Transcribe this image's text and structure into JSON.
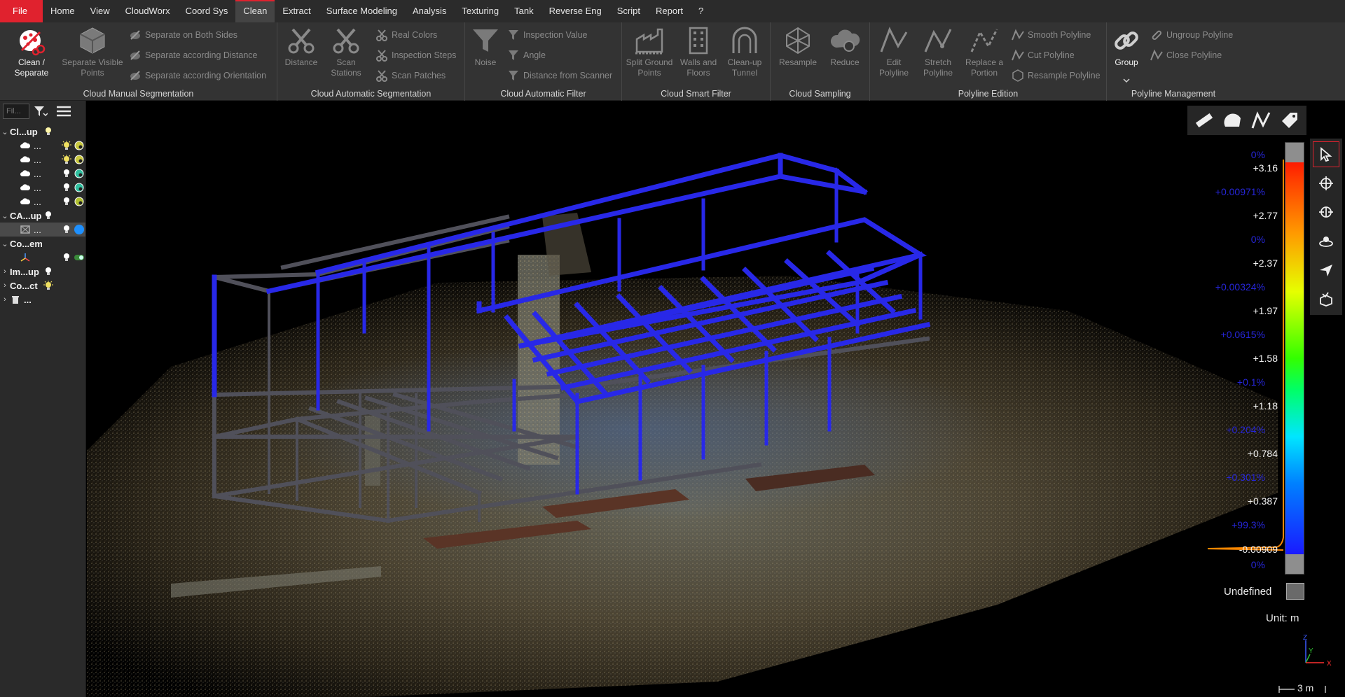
{
  "menu": {
    "items": [
      "File",
      "Home",
      "View",
      "CloudWorx",
      "Coord Sys",
      "Clean",
      "Extract",
      "Surface Modeling",
      "Analysis",
      "Texturing",
      "Tank",
      "Reverse Eng",
      "Script",
      "Report",
      "?"
    ],
    "active": "Clean"
  },
  "ribbon": {
    "manual_segmentation": {
      "label": "Cloud Manual Segmentation",
      "clean_separate": "Clean / Separate",
      "separate_visible": "Separate Visible Points",
      "both_sides": "Separate on Both Sides",
      "by_distance": "Separate according Distance",
      "by_orientation": "Separate according Orientation"
    },
    "auto_segmentation": {
      "label": "Cloud Automatic Segmentation",
      "distance": "Distance",
      "scan_stations": "Scan Stations",
      "real_colors": "Real Colors",
      "inspection_steps": "Inspection Steps",
      "scan_patches": "Scan Patches"
    },
    "auto_filter": {
      "label": "Cloud Automatic Filter",
      "noise": "Noise",
      "inspection_value": "Inspection Value",
      "angle": "Angle",
      "distance_from_scanner": "Distance from Scanner"
    },
    "smart_filter": {
      "label": "Cloud Smart Filter",
      "split_ground": "Split Ground Points",
      "walls_floors": "Walls and Floors",
      "cleanup_tunnel": "Clean-up Tunnel"
    },
    "sampling": {
      "label": "Cloud Sampling",
      "resample": "Resample",
      "reduce": "Reduce"
    },
    "polyline_edition": {
      "label": "Polyline Edition",
      "edit": "Edit Polyline",
      "stretch": "Stretch Polyline",
      "replace": "Replace a Portion",
      "smooth": "Smooth Polyline",
      "cut": "Cut Polyline",
      "resample": "Resample Polyline"
    },
    "polyline_management": {
      "label": "Polyline Management",
      "group": "Group",
      "ungroup": "Ungroup Polyline",
      "close": "Close Polyline"
    }
  },
  "tree": {
    "filter_placeholder": "Fil...",
    "rows": [
      {
        "label": "Cl...up"
      },
      {
        "label": "..."
      },
      {
        "label": "..."
      },
      {
        "label": "..."
      },
      {
        "label": "..."
      },
      {
        "label": "..."
      },
      {
        "label": "CA...up"
      },
      {
        "label": "..."
      },
      {
        "label": "Co...em"
      },
      {
        "label": ""
      },
      {
        "label": "Im...up"
      },
      {
        "label": "Co...ct"
      },
      {
        "label": "..."
      }
    ]
  },
  "scale": {
    "labels": [
      {
        "text": "0%",
        "kind": "pct"
      },
      {
        "text": "+3.16",
        "kind": "val"
      },
      {
        "text": "+0.00971%",
        "kind": "pct"
      },
      {
        "text": "+2.77",
        "kind": "val"
      },
      {
        "text": "0%",
        "kind": "pct"
      },
      {
        "text": "+2.37",
        "kind": "val"
      },
      {
        "text": "+0.00324%",
        "kind": "pct"
      },
      {
        "text": "+1.97",
        "kind": "val"
      },
      {
        "text": "+0.0615%",
        "kind": "pct"
      },
      {
        "text": "+1.58",
        "kind": "val"
      },
      {
        "text": "+0.1%",
        "kind": "pct"
      },
      {
        "text": "+1.18",
        "kind": "val"
      },
      {
        "text": "+0.204%",
        "kind": "pct"
      },
      {
        "text": "+0.784",
        "kind": "val"
      },
      {
        "text": "+0.301%",
        "kind": "pct"
      },
      {
        "text": "+0.387",
        "kind": "val"
      },
      {
        "text": "+99.3%",
        "kind": "pct"
      },
      {
        "text": "-0.00909",
        "kind": "val"
      },
      {
        "text": "0%",
        "kind": "pct"
      }
    ],
    "undefined_label": "Undefined",
    "unit_label": "Unit: m",
    "distance_label": "3 m"
  },
  "colors": {
    "accent": "#e0222e",
    "beam_blue": "#2a2af0",
    "beam_grey": "#505058",
    "panel": "#2a2a2a",
    "ribbon": "#333333"
  }
}
